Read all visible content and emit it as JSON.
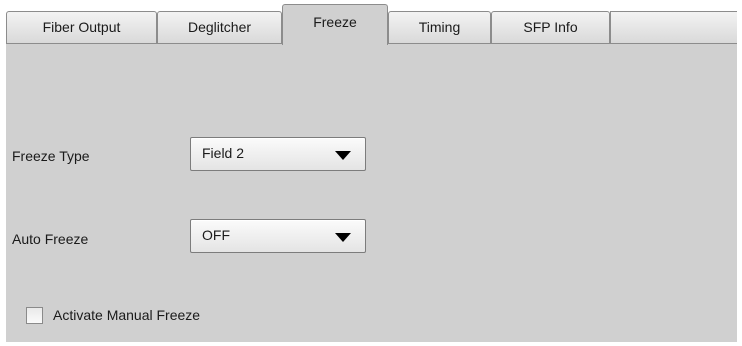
{
  "tabs": [
    {
      "label": "Fiber Output",
      "active": false
    },
    {
      "label": "Deglitcher",
      "active": false
    },
    {
      "label": "Freeze",
      "active": true
    },
    {
      "label": "Timing",
      "active": false
    },
    {
      "label": "SFP Info",
      "active": false
    }
  ],
  "freeze_type": {
    "label": "Freeze Type",
    "value": "Field 2"
  },
  "auto_freeze": {
    "label": "Auto Freeze",
    "value": "OFF"
  },
  "manual_freeze": {
    "label": "Activate Manual Freeze",
    "checked": false
  },
  "colors": {
    "panel_background": "#d0d0d0",
    "tab_border": "#8c8c8c"
  }
}
